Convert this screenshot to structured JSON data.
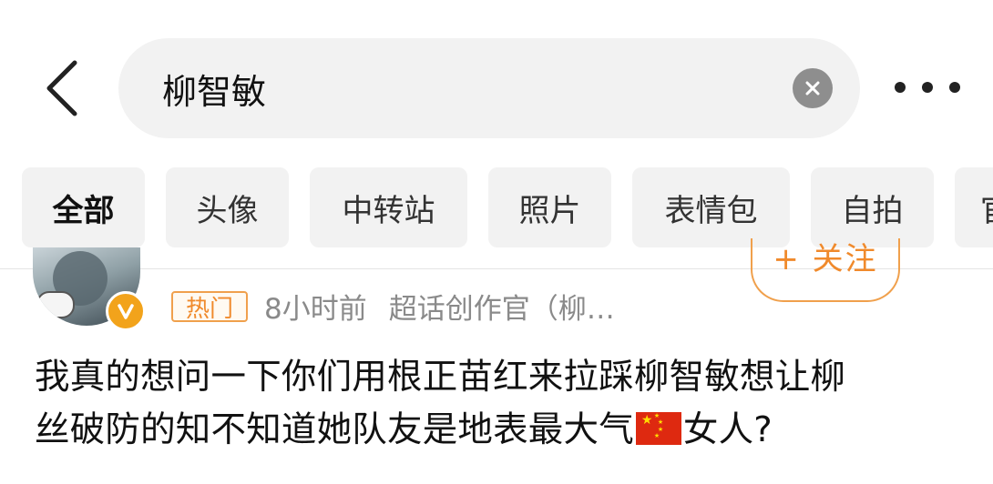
{
  "search": {
    "query": "柳智敏"
  },
  "tabs": [
    {
      "label": "全部",
      "active": true
    },
    {
      "label": "头像",
      "active": false
    },
    {
      "label": "中转站",
      "active": false
    },
    {
      "label": "照片",
      "active": false
    },
    {
      "label": "表情包",
      "active": false
    },
    {
      "label": "自拍",
      "active": false
    },
    {
      "label": "官",
      "active": false
    }
  ],
  "post": {
    "follow_label": "+ 关注",
    "hot_badge": "热门",
    "time": "8小时前",
    "source": "超话创作官（柳…",
    "text_line1": "我真的想问一下你们用根正苗红来拉踩柳智敏想让柳",
    "text_line2a": "丝破防的知不知道她队友是地表最大气",
    "text_line2b": "女人?",
    "flag_icon": "china-flag-emoji"
  },
  "colors": {
    "accent_orange": "#f08a2c",
    "search_bg": "#f2f2f2",
    "verified_badge": "#f2a31b"
  }
}
